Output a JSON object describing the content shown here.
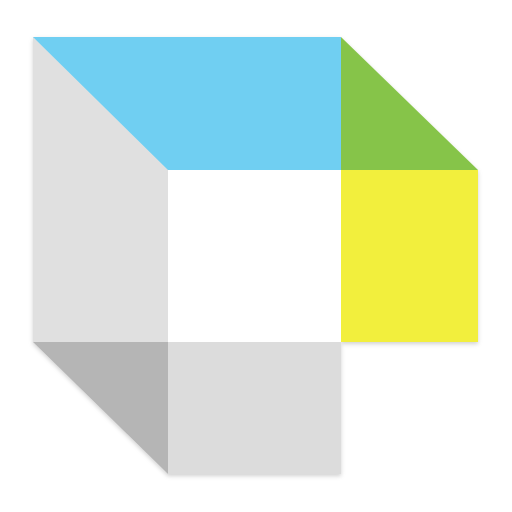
{
  "logo": {
    "icon": "geometric-square-logo-icon",
    "colors": {
      "top_face": "#6FCFF2",
      "right_triangle": "#86C44A",
      "right_square": "#F2EF3C",
      "left_face": "#E0E0E0",
      "bottom_face": "#DCDCDC",
      "bottom_left_shadow": "#B5B5B5",
      "inner_hole": "#FFFFFF"
    }
  }
}
